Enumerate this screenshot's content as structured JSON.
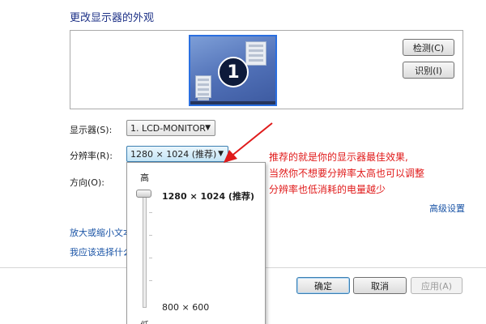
{
  "page": {
    "title": "更改显示器的外观"
  },
  "preview": {
    "monitor_number": "1",
    "detect_label": "检测(C)",
    "identify_label": "识别(I)"
  },
  "fields": {
    "display_label": "显示器(S):",
    "display_value": "1. LCD-MONITOR",
    "resolution_label": "分辨率(R):",
    "resolution_value": "1280 × 1024 (推荐)",
    "orientation_label": "方向(O):"
  },
  "dropdown": {
    "high_label": "高",
    "top_option": "1280 × 1024 (推荐)",
    "bottom_option": "800 × 600",
    "low_label": "低"
  },
  "links": {
    "advanced": "高级设置",
    "enlarge_text": "放大或缩小文本",
    "which_settings": "我应该选择什么"
  },
  "footer": {
    "ok_label": "确定",
    "cancel_label": "取消",
    "apply_label": "应用(A)"
  },
  "annotation": {
    "line1": "推荐的就是你的显示器最佳效果,",
    "line2": "当然你不想要分辨率太高也可以调整",
    "line3": "分辨率也低消耗的电量越少"
  },
  "colors": {
    "title": "#1e3287",
    "link": "#1a54a6",
    "annotation": "#e01a1a",
    "monitor_border": "#2a6fe0"
  },
  "icons": {
    "dropdown_arrow": "chevron-down-icon",
    "annotation_arrow": "red-arrow-icon"
  }
}
